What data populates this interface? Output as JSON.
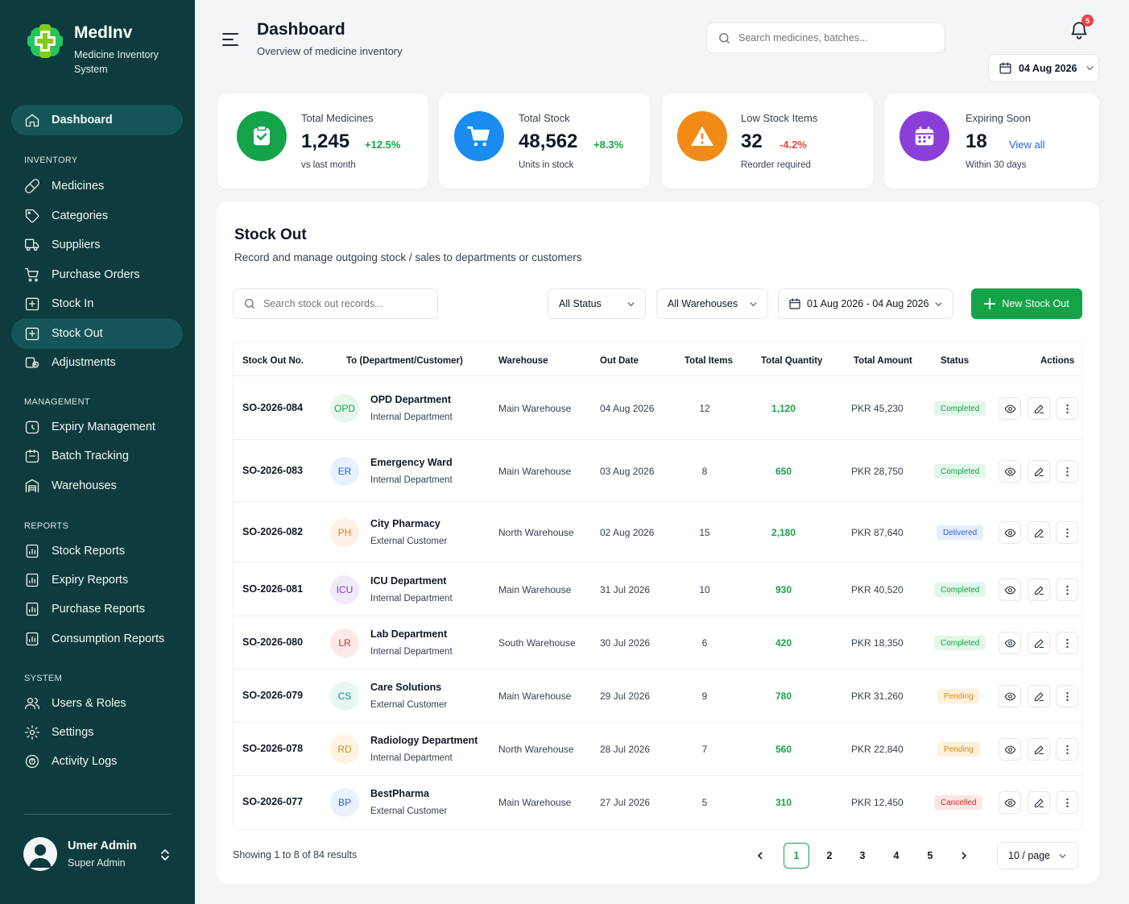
{
  "app": {
    "name": "MedInv",
    "tagline": "Medicine Inventory System"
  },
  "colors": {
    "sidebar": "#0d3b3e",
    "primary": "#15a34a",
    "orange": "#f28b15",
    "blue": "#1a8cf0",
    "purple": "#8b3fd9",
    "red": "#ef4444"
  },
  "sidebar": {
    "dashboard": {
      "label": "Dashboard",
      "icon": "home-icon"
    },
    "sections": {
      "inventory": "INVENTORY",
      "management": "MANAGEMENT",
      "reports": "REPORTS",
      "system": "SYSTEM"
    },
    "inventory": [
      {
        "label": "Medicines",
        "icon": "pill-icon"
      },
      {
        "label": "Categories",
        "icon": "tag-icon"
      },
      {
        "label": "Suppliers",
        "icon": "truck-icon"
      },
      {
        "label": "Purchase Orders",
        "icon": "cart-icon"
      },
      {
        "label": "Stock In",
        "icon": "stock-in-icon"
      },
      {
        "label": "Stock Out",
        "icon": "stock-out-icon",
        "active": true
      },
      {
        "label": "Adjustments",
        "icon": "adjust-icon"
      }
    ],
    "management": [
      {
        "label": "Expiry Management",
        "icon": "clock-icon"
      },
      {
        "label": "Batch Tracking",
        "icon": "box-icon"
      },
      {
        "label": "Warehouses",
        "icon": "warehouse-icon"
      }
    ],
    "reports": [
      {
        "label": "Stock Reports",
        "icon": "report-icon"
      },
      {
        "label": "Expiry Reports",
        "icon": "report-icon"
      },
      {
        "label": "Purchase Reports",
        "icon": "report-icon"
      },
      {
        "label": "Consumption Reports",
        "icon": "report-icon"
      }
    ],
    "system": [
      {
        "label": "Users & Roles",
        "icon": "users-icon"
      },
      {
        "label": "Settings",
        "icon": "gear-icon"
      },
      {
        "label": "Activity Logs",
        "icon": "activity-icon"
      }
    ],
    "user": {
      "name": "Umer Admin",
      "role": "Super Admin"
    }
  },
  "header": {
    "title": "Dashboard",
    "subtitle": "Overview of medicine inventory",
    "search_placeholder": "Search medicines, batches...",
    "notifications": "5",
    "date": "04 Aug 2026"
  },
  "stats": [
    {
      "label": "Total Medicines",
      "value": "1,245",
      "delta": "+12.5%",
      "foot": "vs last month",
      "icon": "clipboard-icon"
    },
    {
      "label": "Total Stock",
      "value": "48,562",
      "delta": "+8.3%",
      "foot": "Units in stock",
      "icon": "cart-icon"
    },
    {
      "label": "Low Stock Items",
      "value": "32",
      "delta": "-4.2%",
      "foot": "Reorder required",
      "icon": "warning-icon"
    },
    {
      "label": "Expiring Soon",
      "value": "18",
      "link": "View all",
      "foot": "Within 30 days",
      "icon": "calendar-icon"
    }
  ],
  "stock_out": {
    "title": "Stock Out",
    "subtitle": "Record and manage outgoing stock / sales to departments or customers",
    "search_placeholder": "Search stock out records...",
    "status_filter": "All Status",
    "warehouse_filter": "All Warehouses",
    "date_range": "01 Aug 2026 - 04 Aug 2026",
    "new_button": "New Stock Out",
    "columns": [
      "Stock Out No.",
      "To (Department/Customer)",
      "Warehouse",
      "Out Date",
      "Total Items",
      "Total Quantity",
      "Total Amount",
      "Status",
      "Actions"
    ],
    "rows": [
      {
        "no": "SO-2026-084",
        "abbr": "OPD",
        "name": "OPD Department",
        "type": "Internal Department",
        "warehouse": "Main Warehouse",
        "date": "04 Aug 2026",
        "items": "12",
        "qty": "1,120",
        "amount": "PKR 45,230",
        "status": "Completed"
      },
      {
        "no": "SO-2026-083",
        "abbr": "ER",
        "name": "Emergency Ward",
        "type": "Internal Department",
        "warehouse": "Main Warehouse",
        "date": "03 Aug 2026",
        "items": "8",
        "qty": "650",
        "amount": "PKR 28,750",
        "status": "Completed"
      },
      {
        "no": "SO-2026-082",
        "abbr": "PH",
        "name": "City Pharmacy",
        "type": "External Customer",
        "warehouse": "North Warehouse",
        "date": "02 Aug 2026",
        "items": "15",
        "qty": "2,180",
        "amount": "PKR 87,640",
        "status": "Delivered"
      },
      {
        "no": "SO-2026-081",
        "abbr": "ICU",
        "name": "ICU Department",
        "type": "Internal Department",
        "warehouse": "Main Warehouse",
        "date": "31 Jul 2026",
        "items": "10",
        "qty": "930",
        "amount": "PKR 40,520",
        "status": "Completed"
      },
      {
        "no": "SO-2026-080",
        "abbr": "LR",
        "name": "Lab Department",
        "type": "Internal Department",
        "warehouse": "South Warehouse",
        "date": "30 Jul 2026",
        "items": "6",
        "qty": "420",
        "amount": "PKR 18,350",
        "status": "Completed"
      },
      {
        "no": "SO-2026-079",
        "abbr": "CS",
        "name": "Care Solutions",
        "type": "External Customer",
        "warehouse": "Main Warehouse",
        "date": "29 Jul 2026",
        "items": "9",
        "qty": "780",
        "amount": "PKR 31,260",
        "status": "Pending"
      },
      {
        "no": "SO-2026-078",
        "abbr": "RD",
        "name": "Radiology Department",
        "type": "Internal Department",
        "warehouse": "North Warehouse",
        "date": "28 Jul 2026",
        "items": "7",
        "qty": "560",
        "amount": "PKR 22,840",
        "status": "Pending"
      },
      {
        "no": "SO-2026-077",
        "abbr": "BP",
        "name": "BestPharma",
        "type": "External Customer",
        "warehouse": "Main Warehouse",
        "date": "27 Jul 2026",
        "items": "5",
        "qty": "310",
        "amount": "PKR 12,450",
        "status": "Cancelled"
      }
    ],
    "showing": "Showing 1 to 8 of 84 results",
    "pages": [
      "1",
      "2",
      "3",
      "4",
      "5"
    ],
    "current_page": "1",
    "per_page": "10 / page"
  }
}
